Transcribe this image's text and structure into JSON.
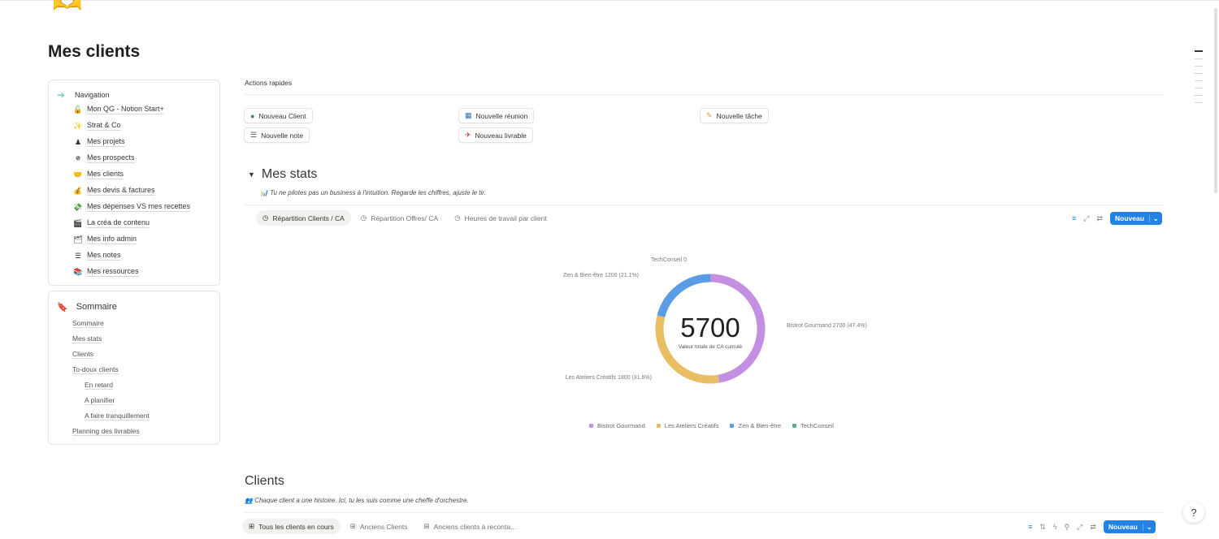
{
  "page": {
    "title": "Mes clients",
    "top_emoji": "🫶"
  },
  "navigation": {
    "title": "Navigation",
    "items": [
      {
        "icon": "🔓",
        "label": "Mon QG - Notion Start+"
      },
      {
        "icon": "✨",
        "label": "Strat & Co"
      },
      {
        "icon": "♟",
        "label": "Mes projets"
      },
      {
        "icon": "✵",
        "label": "Mes prospects"
      },
      {
        "icon": "🤝",
        "label": "Mes clients"
      },
      {
        "icon": "💰",
        "label": "Mes devis & factures"
      },
      {
        "icon": "💸",
        "label": "Mes dépenses VS mes recettes"
      },
      {
        "icon": "🎬",
        "label": "La créa de contenu"
      },
      {
        "icon": "🗂",
        "label": "Mes info admin"
      },
      {
        "icon": "☰",
        "label": "Mes notes"
      },
      {
        "icon": "📚",
        "label": "Mes ressources"
      }
    ]
  },
  "sommaire": {
    "title": "Sommaire",
    "items": [
      {
        "label": "Sommaire",
        "sub": false
      },
      {
        "label": "Mes stats",
        "sub": false
      },
      {
        "label": "Clients",
        "sub": false
      },
      {
        "label": "To-doux clients",
        "sub": false
      },
      {
        "label": "En retard",
        "sub": true
      },
      {
        "label": "A planifier",
        "sub": true
      },
      {
        "label": "A faire tranquillement",
        "sub": true
      },
      {
        "label": "Planning des livrables",
        "sub": false
      }
    ]
  },
  "quick_actions": {
    "title": "Actions rapides",
    "buttons": [
      {
        "label": "Nouveau Client",
        "icon": "●"
      },
      {
        "label": "Nouvelle réunion",
        "icon": "▦"
      },
      {
        "label": "Nouvelle tâche",
        "icon": "✎"
      },
      {
        "label": "Nouvelle note",
        "icon": "☰"
      },
      {
        "label": "Nouveau livrable",
        "icon": "✈"
      }
    ]
  },
  "stats": {
    "title": "Mes stats",
    "subtitle": "Tu ne pilotes pas un business à l'intuition. Regarde les chiffres, ajuste le tir.",
    "tabs": [
      "Répartition Clients / CA",
      "Répartition Offres/ CA",
      "Heures de travail par client"
    ],
    "new_label": "Nouveau"
  },
  "chart_data": {
    "type": "pie",
    "variant": "donut",
    "center_value": "5700",
    "center_label": "Valeur totale de CA cumulé",
    "categories": [
      "Bistrot Gourmand",
      "Les Ateliers Créatifs",
      "Zen & Bien-être",
      "TechConseil"
    ],
    "values": [
      2700,
      1800,
      1200,
      0
    ],
    "percents": [
      "47.4%",
      "31.6%",
      "21.1%",
      ""
    ],
    "data_labels": [
      "Bistrot Gourmand 2700 (47.4%)",
      "Les Ateliers Créatifs 1800 (31.6%)",
      "Zen & Bien-être 1200 (21.1%)",
      "TechConseil 0"
    ],
    "colors": [
      "#c38fe0",
      "#e9bd63",
      "#5a9ce6",
      "#5fae88"
    ],
    "legend": "bottom"
  },
  "clients": {
    "title": "Clients",
    "subtitle": "Chaque client a une histoire. Ici, tu les suis comme une cheffe d'orchestre.",
    "tabs": [
      "Tous les clients en cours",
      "Anciens Clients",
      "Anciens clients à reconta..."
    ],
    "new_label": "Nouveau"
  },
  "help": {
    "icon": "?"
  }
}
